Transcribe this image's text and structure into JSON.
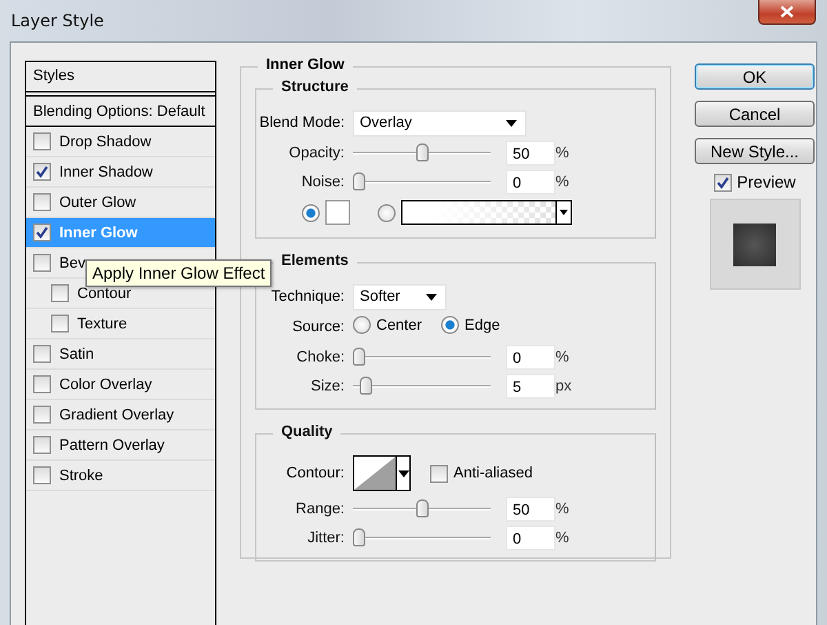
{
  "window": {
    "title": "Layer Style"
  },
  "styles_list": {
    "header": "Styles",
    "items": [
      {
        "label": "Blending Options: Default",
        "kind": "plain",
        "selected": false
      },
      {
        "label": "Drop Shadow",
        "kind": "check",
        "checked": false,
        "selected": false
      },
      {
        "label": "Inner Shadow",
        "kind": "check",
        "checked": true,
        "selected": false
      },
      {
        "label": "Outer Glow",
        "kind": "check",
        "checked": false,
        "selected": false
      },
      {
        "label": "Inner Glow",
        "kind": "check",
        "checked": true,
        "selected": true
      },
      {
        "label": "Bev",
        "kind": "check",
        "checked": false,
        "selected": false,
        "children": [
          {
            "label": "Contour",
            "kind": "check",
            "checked": false,
            "selected": false
          },
          {
            "label": "Texture",
            "kind": "check",
            "checked": false,
            "selected": false
          }
        ]
      },
      {
        "label": "Satin",
        "kind": "check",
        "checked": false,
        "selected": false
      },
      {
        "label": "Color Overlay",
        "kind": "check",
        "checked": false,
        "selected": false
      },
      {
        "label": "Gradient Overlay",
        "kind": "check",
        "checked": false,
        "selected": false
      },
      {
        "label": "Pattern Overlay",
        "kind": "check",
        "checked": false,
        "selected": false
      },
      {
        "label": "Stroke",
        "kind": "check",
        "checked": false,
        "selected": false
      }
    ]
  },
  "tooltip": "Apply Inner Glow Effect",
  "panel": {
    "title": "Inner Glow",
    "structure": {
      "title": "Structure",
      "blend_mode": {
        "label": "Blend Mode:",
        "value": "Overlay"
      },
      "sliders": [
        {
          "label": "Opacity:",
          "level": 0.5,
          "value": "50",
          "unit": "%"
        },
        {
          "label": "Noise:",
          "level": 0,
          "value": "0",
          "unit": "%"
        }
      ],
      "fill_options": [
        {
          "kind": "swatch",
          "selected": true
        },
        {
          "kind": "gradient",
          "selected": false
        }
      ]
    },
    "elements": {
      "title": "Elements",
      "technique": {
        "label": "Technique:",
        "value": "Softer"
      },
      "source": {
        "label": "Source:",
        "options": [
          {
            "label": "Center",
            "selected": false
          },
          {
            "label": "Edge",
            "selected": true
          }
        ]
      },
      "sliders": [
        {
          "label": "Choke:",
          "level": 0,
          "value": "0",
          "unit": "%"
        },
        {
          "label": "Size:",
          "level": 0.05,
          "value": "5",
          "unit": "px"
        }
      ]
    },
    "quality": {
      "title": "Quality",
      "contour": {
        "label": "Contour:"
      },
      "anti_aliased": {
        "label": "Anti-aliased",
        "checked": false
      },
      "sliders": [
        {
          "label": "Range:",
          "level": 0.5,
          "value": "50",
          "unit": "%"
        },
        {
          "label": "Jitter:",
          "level": 0,
          "value": "0",
          "unit": "%"
        }
      ]
    }
  },
  "buttons": [
    {
      "label": "OK",
      "default": true
    },
    {
      "label": "Cancel",
      "default": false
    },
    {
      "label": "New Style...",
      "default": false
    }
  ],
  "preview": {
    "label": "Preview",
    "checked": true
  }
}
